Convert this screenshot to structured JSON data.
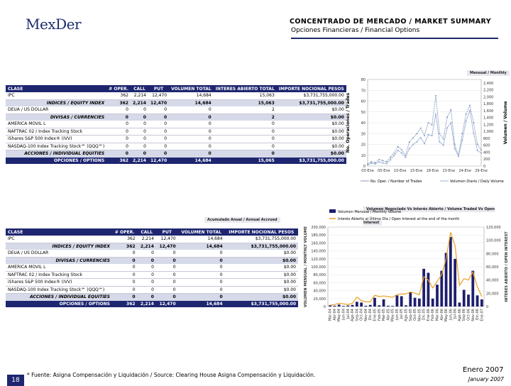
{
  "logo": {
    "text": "MexDer"
  },
  "header": {
    "title": "CONCENTRADO DE MERCADO / MARKET SUMMARY",
    "subtitle": "Opciones Financieras / Financial Options"
  },
  "table1": {
    "caption": "Mensual / Monthly",
    "headers": [
      "CLASE",
      "# OPER.",
      "CALL",
      "PUT",
      "VOLUMEN TOTAL",
      "INTERES ABIERTO TOTAL",
      "IMPORTE NOCIONAL PESOS"
    ],
    "rows": [
      {
        "kind": "row",
        "cells": [
          "IPC",
          "362",
          "2,214",
          "12,470",
          "14,684",
          "15,063",
          "$3,731,755,000.00"
        ]
      },
      {
        "kind": "sub",
        "cells": [
          "INDICES / EQUITY INDEX",
          "362",
          "2,214",
          "12,470",
          "14,684",
          "15,063",
          "$3,731,755,000.00"
        ]
      },
      {
        "kind": "row",
        "cells": [
          "DEUA / US DOLLAR",
          "0",
          "0",
          "0",
          "0",
          "2",
          "$0.00"
        ]
      },
      {
        "kind": "sub",
        "cells": [
          "DIVISAS / CURRENCIES",
          "0",
          "0",
          "0",
          "0",
          "2",
          "$0.00"
        ]
      },
      {
        "kind": "row",
        "cells": [
          "AMERICA MOVIL L",
          "0",
          "0",
          "0",
          "0",
          "0",
          "$0.00"
        ]
      },
      {
        "kind": "row",
        "cells": [
          "NAFTRAC 02 / Index Tracking Stock",
          "0",
          "0",
          "0",
          "0",
          "0",
          "$0.00"
        ]
      },
      {
        "kind": "row",
        "cells": [
          "iShares S&P 500 Index® (IVV)",
          "0",
          "0",
          "0",
          "0",
          "0",
          "$0.00"
        ]
      },
      {
        "kind": "row",
        "cells": [
          "NASDAQ-100 Index Tracking Stock℠ (QQQ℠)",
          "0",
          "0",
          "0",
          "0",
          "0",
          "$0.00"
        ]
      },
      {
        "kind": "sub",
        "cells": [
          "ACCIONES / INDIVIDUAL EQUITIES",
          "0",
          "0",
          "0",
          "0",
          "0",
          "$0.00"
        ]
      },
      {
        "kind": "tot",
        "cells": [
          "OPCIONES / OPTIONS",
          "362",
          "2,214",
          "12,470",
          "14,684",
          "15,065",
          "$3,731,755,000.00"
        ]
      }
    ]
  },
  "table2": {
    "caption": "Acumulado Anual / Annual Accrued",
    "headers": [
      "CLASE",
      "# OPER.",
      "CALL",
      "PUT",
      "VOLUMEN TOTAL",
      "IMPORTE NOCIONAL PESOS"
    ],
    "rows": [
      {
        "kind": "row",
        "cells": [
          "IPC",
          "362",
          "2,214",
          "12,470",
          "14,684",
          "$3,731,755,000.00"
        ]
      },
      {
        "kind": "sub",
        "cells": [
          "INDICES / EQUITY INDEX",
          "362",
          "2,214",
          "12,470",
          "14,684",
          "$3,731,755,000.00"
        ]
      },
      {
        "kind": "row",
        "cells": [
          "DEUA / US DOLLAR",
          "0",
          "0",
          "0",
          "0",
          "$0.00"
        ]
      },
      {
        "kind": "sub",
        "cells": [
          "DIVISAS / CURRENCIES",
          "0",
          "0",
          "0",
          "0",
          "$0.00"
        ]
      },
      {
        "kind": "row",
        "cells": [
          "AMERICA MOVIL L",
          "0",
          "0",
          "0",
          "0",
          "$0.00"
        ]
      },
      {
        "kind": "row",
        "cells": [
          "NAFTRAC 02 / Index Tracking Stock",
          "0",
          "0",
          "0",
          "0",
          "$0.00"
        ]
      },
      {
        "kind": "row",
        "cells": [
          "iShares S&P 500 Index® (IVV)",
          "0",
          "0",
          "0",
          "0",
          "$0.00"
        ]
      },
      {
        "kind": "row",
        "cells": [
          "NASDAQ-100 Index Tracking Stock℠ (QQQ℠)",
          "0",
          "0",
          "0",
          "0",
          "$0.00"
        ]
      },
      {
        "kind": "sub",
        "cells": [
          "ACCIONES / INDIVIDUAL EQUITIES",
          "0",
          "0",
          "0",
          "0",
          "$0.00"
        ]
      },
      {
        "kind": "tot",
        "cells": [
          "OPCIONES / OPTIONS",
          "362",
          "2,214",
          "12,470",
          "14,684",
          "$3,731,755,000.00"
        ]
      }
    ]
  },
  "chart_data": [
    {
      "type": "line",
      "ylabel": "No. Operaciones / Trades",
      "y2label": "Volumen / Volume",
      "x": [
        "03-Ene",
        "05-Ene",
        "10-Ene",
        "15-Ene",
        "18-Ene",
        "23-Ene",
        "24-Ene",
        "29-Ene"
      ],
      "ylim": [
        0,
        80
      ],
      "y2lim": [
        0,
        2500
      ],
      "yticks": [
        0,
        10,
        20,
        30,
        40,
        50,
        60,
        70,
        80
      ],
      "y2ticks": [
        0,
        200,
        400,
        600,
        800,
        1000,
        1200,
        1400,
        1600,
        1800,
        2000,
        2200,
        2400
      ],
      "series": [
        {
          "name": "No. Oper. / Number of Trades",
          "axis": "left",
          "color": "#8899bb",
          "values": [
            2,
            4,
            3,
            6,
            5,
            4,
            8,
            12,
            18,
            15,
            10,
            22,
            26,
            30,
            35,
            28,
            40,
            38,
            65,
            30,
            25,
            45,
            52,
            20,
            10,
            30,
            48,
            56,
            40,
            20,
            15
          ]
        },
        {
          "name": "Volumen Diario / Daily Volume",
          "axis": "right",
          "color": "#9fb4d6",
          "values": [
            30,
            80,
            60,
            120,
            90,
            70,
            180,
            300,
            450,
            380,
            250,
            500,
            620,
            700,
            820,
            650,
            900,
            880,
            1500,
            700,
            600,
            1100,
            1250,
            500,
            280,
            750,
            1300,
            1600,
            950,
            450,
            380
          ]
        }
      ]
    },
    {
      "type": "bar",
      "title": "Volumen Negociado Vs Interés Abierto / Volume Traded Vs Open Interest",
      "ylabel": "VOLUMEN MENSUAL / MONTHLY VOLUME",
      "y2label": "INTERES ABIERTO / OPEN INTEREST",
      "ylim": [
        0,
        200000
      ],
      "y2lim": [
        0,
        120000
      ],
      "yticks": [
        0,
        20000,
        40000,
        60000,
        80000,
        100000,
        120000,
        140000,
        160000,
        180000,
        200000
      ],
      "y2ticks": [
        0,
        20000,
        40000,
        60000,
        80000,
        100000,
        120000
      ],
      "ytick_labels": [
        "0",
        "20,000",
        "40,000",
        "60,000",
        "80,000",
        "100,000",
        "120,000",
        "140,000",
        "160,000",
        "180,000",
        "200,000"
      ],
      "y2tick_labels": [
        "0",
        "20,000",
        "40,000",
        "60,000",
        "80,000",
        "100,000",
        "120,000"
      ],
      "categories": [
        "Mar-04",
        "Abr-04",
        "May-04",
        "Jun-04",
        "Jul-04",
        "Ago-04",
        "Sep-04",
        "Oct-04",
        "Nov-04",
        "Dic-04",
        "Ene-05",
        "Feb-05",
        "Mar-05",
        "Abr-05",
        "May-05",
        "Jun-05",
        "Jul-05",
        "Ago-05",
        "Sep-05",
        "Oct-05",
        "Nov-05",
        "Dic-05",
        "Ene-06",
        "Feb-06",
        "Mar-06",
        "Abr-06",
        "May-06",
        "Jun-06",
        "Jul-06",
        "Ago-06",
        "Sep-06",
        "Oct-06",
        "Nov-06",
        "Dic-06",
        "Ene-07"
      ],
      "series": [
        {
          "name": "Volumen Mensual / Monthly Volume",
          "kind": "bar",
          "color": "#1e1e6e",
          "values": [
            3000,
            2000,
            5000,
            1500,
            2500,
            4000,
            12000,
            10000,
            2000,
            4000,
            22000,
            3000,
            18000,
            2000,
            1500,
            28000,
            26000,
            3000,
            36000,
            22000,
            20000,
            95000,
            85000,
            20000,
            55000,
            90000,
            135000,
            175000,
            120000,
            10000,
            42000,
            30000,
            90000,
            28000,
            18000
          ]
        },
        {
          "name": "Interés Abierto al Último Día / Open Interest at the end of the month",
          "kind": "line",
          "color": "#e8a020",
          "values": [
            2000,
            3000,
            5000,
            4000,
            3000,
            5000,
            14000,
            9000,
            7000,
            7000,
            17000,
            15000,
            16000,
            15000,
            14000,
            18000,
            19000,
            19000,
            22000,
            20000,
            18000,
            45000,
            40000,
            28000,
            38000,
            48000,
            72000,
            112000,
            92000,
            32000,
            42000,
            40000,
            52000,
            30000,
            15000
          ]
        }
      ]
    }
  ],
  "footer": {
    "page_number": "18",
    "footnote": "* Fuente: Asigna Compensación y Liquidación / Source: Clearing House Asigna Compensación y Liquidación.",
    "date_es": "Enero 2007",
    "date_en": "January 2007"
  }
}
